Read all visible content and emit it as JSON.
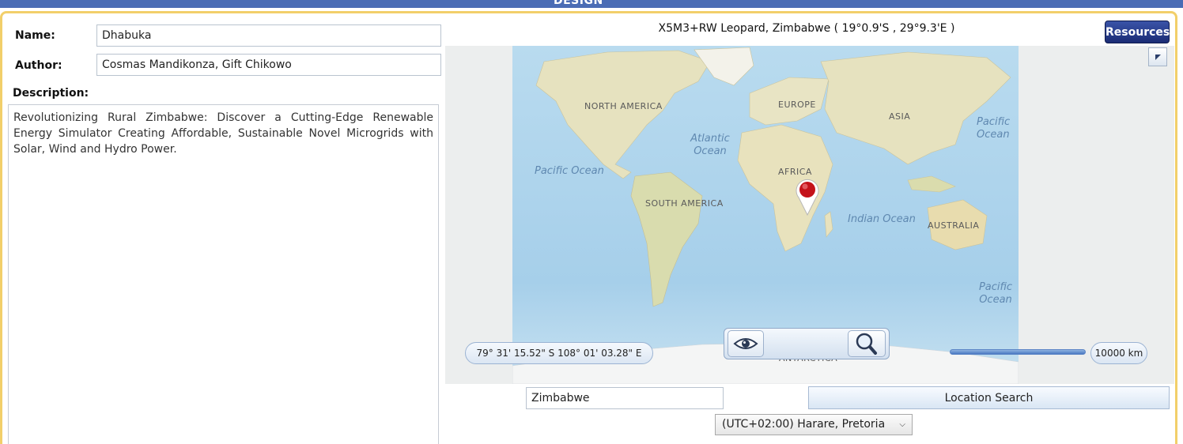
{
  "window": {
    "title": "DESIGN"
  },
  "form": {
    "name_label": "Name:",
    "name_value": "Dhabuka",
    "author_label": "Author:",
    "author_value": "Cosmas Mandikonza, Gift Chikowo",
    "description_label": "Description:",
    "description_value": "Revolutionizing Rural Zimbabwe: Discover a Cutting-Edge Renewable Energy Simulator Creating Affordable, Sustainable Novel Microgrids with Solar, Wind and Hydro Power."
  },
  "location": {
    "title": "X5M3+RW Leopard, Zimbabwe ( 19°0.9'S , 29°9.3'E )",
    "resources_label": "Resources"
  },
  "map": {
    "cursor_coords": "79° 31' 15.52\" S 108° 01' 03.28\" E",
    "scale_label": "10000 km",
    "continents": {
      "north_america": "NORTH AMERICA",
      "south_america": "SOUTH AMERICA",
      "europe": "EUROPE",
      "africa": "AFRICA",
      "asia": "ASIA",
      "australia": "AUSTRALIA",
      "antarctica": "ANTARCTICA"
    },
    "oceans": {
      "atlantic": "Atlantic Ocean",
      "pacific_west": "Pacific Ocean",
      "pacific_ne": "Pacific Ocean",
      "pacific_se": "Pacific Ocean",
      "indian": "Indian Ocean"
    },
    "colors": {
      "water": "#b8d8ee",
      "land": "#e8e4c4",
      "marker": "#c4121a"
    },
    "icons": {
      "view": "eye-icon",
      "search": "magnifier-icon",
      "marker": "map-pin-icon"
    }
  },
  "search": {
    "query": "Zimbabwe",
    "button_label": "Location Search"
  },
  "timezone": {
    "selected": "(UTC+02:00) Harare, Pretoria"
  }
}
